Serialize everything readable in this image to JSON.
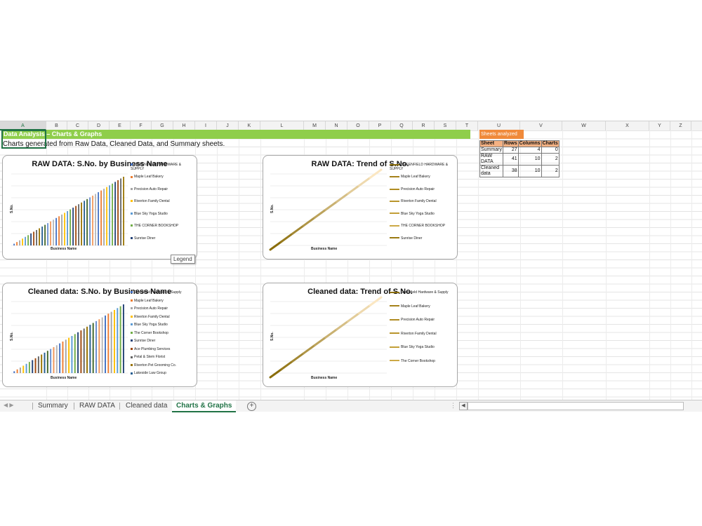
{
  "columns": [
    "A",
    "B",
    "C",
    "D",
    "E",
    "F",
    "G",
    "H",
    "I",
    "J",
    "K",
    "L",
    "M",
    "N",
    "O",
    "P",
    "Q",
    "R",
    "S",
    "T",
    "U",
    "V",
    "W",
    "X",
    "Y",
    "Z"
  ],
  "banner": "Data Analysis – Charts & Graphs",
  "subtitle": "Charts generated from Raw Data, Cleaned Data, and Summary sheets.",
  "legend_tooltip": "Legend",
  "summary": {
    "heading": "Sheets analyzed",
    "headers": [
      "Sheet",
      "Rows",
      "Columns",
      "Charts"
    ],
    "rows": [
      [
        "Summary",
        "27",
        "4",
        "0"
      ],
      [
        "RAW DATA",
        "41",
        "10",
        "2"
      ],
      [
        "Cleaned data",
        "38",
        "10",
        "2"
      ]
    ]
  },
  "tabs": [
    "Summary",
    "RAW DATA",
    "Cleaned data",
    "Charts & Graphs"
  ],
  "active_tab": "Charts & Graphs",
  "charts": [
    {
      "id": "raw-bar",
      "title": "RAW DATA: S.No. by Business Name",
      "type": "bar",
      "xlabel": "Business Name",
      "ylabel": "S.No.",
      "bars": 40,
      "legend": [
        "GREENFIELD HARDWARE & SUPPLY",
        "Maple Leaf Bakery",
        "Precision Auto Repair",
        "Riverton Family Dental",
        "Blue Sky Yoga Studio",
        "THE CORNER BOOKSHOP",
        "Sunrise Diner"
      ]
    },
    {
      "id": "raw-line",
      "title": "RAW DATA: Trend of S.No.",
      "type": "line",
      "xlabel": "Business Name",
      "ylabel": "S.No.",
      "legend": [
        "GREENFIELD HARDWARE & SUPPLY",
        "Maple Leaf Bakery",
        "Precision Auto Repair",
        "Riverton Family Dental",
        "Blue Sky Yoga Studio",
        "THE CORNER BOOKSHOP",
        "Sunrise Diner"
      ]
    },
    {
      "id": "clean-bar",
      "title": "Cleaned data: S.No. by Business Name",
      "type": "bar",
      "xlabel": "Business Name",
      "ylabel": "S.No.",
      "bars": 37,
      "legend": [
        "Greenfield Hardware & Supply",
        "Maple Leaf Bakery",
        "Precision Auto Repair",
        "Riverton Family Dental",
        "Blue Sky Yoga Studio",
        "The Corner Bookshop",
        "Sunrise Diner",
        "Ace Plumbing Services",
        "Petal & Stem Florist",
        "Riverton Pet Grooming Co.",
        "Lakeside Law Group"
      ]
    },
    {
      "id": "clean-line",
      "title": "Cleaned data: Trend of S.No.",
      "type": "line",
      "xlabel": "Business Name",
      "ylabel": "S.No.",
      "legend": [
        "Greenfield Hardware & Supply",
        "Maple Leaf Bakery",
        "Precision Auto Repair",
        "Riverton Family Dental",
        "Blue Sky Yoga Studio",
        "The Corner Bookshop"
      ]
    }
  ],
  "colors": {
    "banner": "#8fce4b",
    "accent": "#217346",
    "summary_head": "#f08a3a",
    "summary_th": "#f4b183",
    "line_dark": "#8a6d0b",
    "line_light": "#fbe7c2"
  }
}
